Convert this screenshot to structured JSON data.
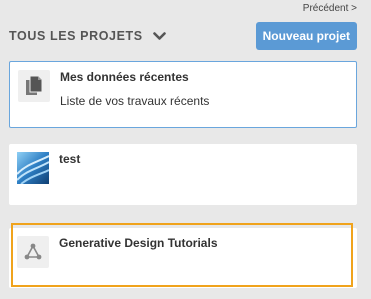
{
  "nav": {
    "previous_label": "Précédent >"
  },
  "header": {
    "all_projects_label": "TOUS LES PROJETS",
    "new_project_label": "Nouveau projet"
  },
  "projects": [
    {
      "title": "Mes données récentes",
      "subtitle": "Liste de vos travaux récents",
      "icon": "recent-data-icon"
    },
    {
      "title": "test",
      "icon": "project-thumbnail"
    },
    {
      "title": "Generative Design Tutorials",
      "icon": "generative-design-icon"
    }
  ],
  "colors": {
    "accent": "#5b9ad5",
    "highlight": "#f0a31c",
    "selected_border": "#6aa6dd",
    "background": "#e8e8e8"
  }
}
